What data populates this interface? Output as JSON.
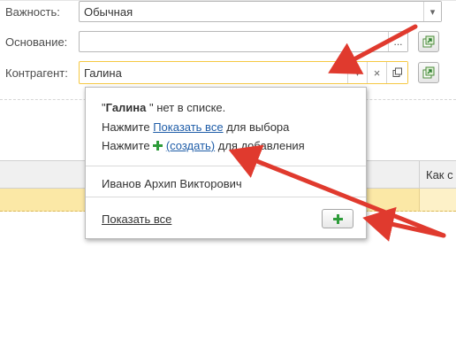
{
  "form": {
    "importance_label": "Важность:",
    "importance_value": "Обычная",
    "basis_label": "Основание:",
    "basis_value": "",
    "basis_button": "...",
    "counterparty_label": "Контрагент:",
    "counterparty_value": "Галина",
    "clear_button": "×"
  },
  "table": {
    "right_header": "Как с"
  },
  "popup": {
    "not_found_prefix": "\"",
    "not_found_name": "Галина",
    "not_found_suffix": " \" нет в списке.",
    "press1": "Нажмите",
    "show_all_inline": "Показать все",
    "for_select": "для выбора",
    "press2": "Нажмите",
    "create_link": "(создать)",
    "for_add": "для добавления",
    "item": "Иванов Архип Викторович",
    "show_all_footer": "Показать все"
  },
  "colors": {
    "accent_yellow": "#f5c842",
    "row_highlight": "#fbe8a6",
    "arrow_red": "#e03a2e",
    "plus_green": "#2e9c3a",
    "link_blue": "#1f5da8"
  }
}
